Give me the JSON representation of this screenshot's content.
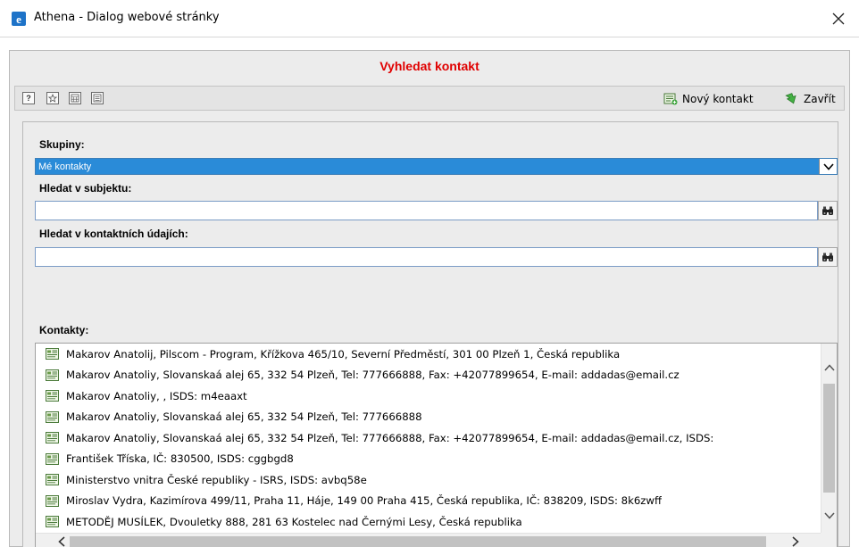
{
  "window": {
    "title": "Athena - Dialog webové stránky"
  },
  "dialog": {
    "heading": "Vyhledat kontakt"
  },
  "toolbar": {
    "new_contact_label": "Nový kontakt",
    "close_label": "Zavřít"
  },
  "form": {
    "groups_label": "Skupiny:",
    "groups_selected": "Mé kontakty",
    "search_subject_label": "Hledat v subjektu:",
    "search_subject_value": "",
    "search_contact_label": "Hledat v kontaktních údajích:",
    "search_contact_value": "",
    "contacts_label": "Kontakty:"
  },
  "contacts": [
    "Makarov Anatolij, Pilscom - Program, Křížkova 465/10, Severní Předměstí, 301 00 Plzeň 1, Česká republika",
    "Makarov Anatoliy, Slovanskaá alej 65, 332 54 Plzeň, Tel: 777666888, Fax: +42077899654, E-mail: addadas@email.cz",
    "Makarov Anatoliy, , ISDS: m4eaaxt",
    "Makarov Anatoliy, Slovanskaá alej 65, 332 54 Plzeň, Tel: 777666888",
    "Makarov Anatoliy, Slovanskaá alej 65, 332 54 Plzeň, Tel: 777666888, Fax: +42077899654, E-mail: addadas@email.cz, ISDS:",
    "František Tříska, IČ: 830500, ISDS: cggbgd8",
    "Ministerstvo vnitra České republiky - ISRS, ISDS: avbq58e",
    "Miroslav Vydra, Kazimírova 499/11, Praha 11, Háje, 149 00 Praha 415, Česká republika, IČ: 838209, ISDS: 8k6zwff",
    "METODĚJ MUSÍLEK, Dvouletky 888, 281 63 Kostelec nad Černými Lesy, Česká republika"
  ],
  "colors": {
    "heading": "#e00000",
    "select_bg": "#2a8bd8",
    "dialog_bg": "#ececec"
  }
}
